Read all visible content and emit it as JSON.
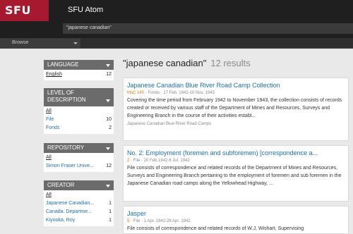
{
  "header": {
    "logo": "SFU",
    "site_title": "SFU Atom",
    "search_value": "\"japanese canadian\"",
    "browse_label": "Browse"
  },
  "facets": {
    "language": {
      "title": "LANGUAGE",
      "items": [
        {
          "label": "English",
          "count": "12"
        }
      ]
    },
    "level": {
      "title": "LEVEL OF DESCRIPTION",
      "items": [
        {
          "label": "All",
          "count": ""
        },
        {
          "label": "File",
          "count": "10"
        },
        {
          "label": "Fonds",
          "count": "2"
        }
      ]
    },
    "repository": {
      "title": "REPOSITORY",
      "items": [
        {
          "label": "All",
          "count": ""
        },
        {
          "label": "Simon Fraser Unive...",
          "count": "12"
        }
      ]
    },
    "creator": {
      "title": "CREATOR",
      "items": [
        {
          "label": "All",
          "count": ""
        },
        {
          "label": "Japanese Canadian...",
          "count": "1"
        },
        {
          "label": "Canada. Departme...",
          "count": "1"
        },
        {
          "label": "Kiyooka, Roy",
          "count": "1"
        }
      ]
    }
  },
  "results": {
    "query": "\"japanese canadian\"",
    "count_label": "12 results",
    "items": [
      {
        "title": "Japanese Canadian Blue River Road Camp Collection",
        "ref": "MsC 140",
        "meta": " · Fonds · 17 Feb. 1942-10 Nov. 1943",
        "desc": "Covering the time period from February 1942 to November 1943, the collection consists of records created or received by various staff of the Department of Mines and Resources, Surveys and Engineering Branch in the course of their activities establ...",
        "foot": "Japanese Canadian Blue River Road Camps"
      },
      {
        "title": "No. 2: Employment (foremen and subforemen) [correspondence a...",
        "ref": "2",
        "meta": " · File · 20 Feb.1942-6 Jul. 1942",
        "desc": "File consists of correspondence and related records of the Department of Mines and Resources, Surveys and Engineering Branch pertaining to the employment of foremen and sub foremen in the Japanese Canadian road camps along the Yellowhead Highway, ...",
        "foot": ""
      },
      {
        "title": "Jasper",
        "ref": "5",
        "meta": " · File · 1 Apr. 1942-28 Apr. 1942",
        "desc": "File consists of correspondence and related records of W.J. Wishart, Supervising",
        "foot": ""
      }
    ]
  }
}
